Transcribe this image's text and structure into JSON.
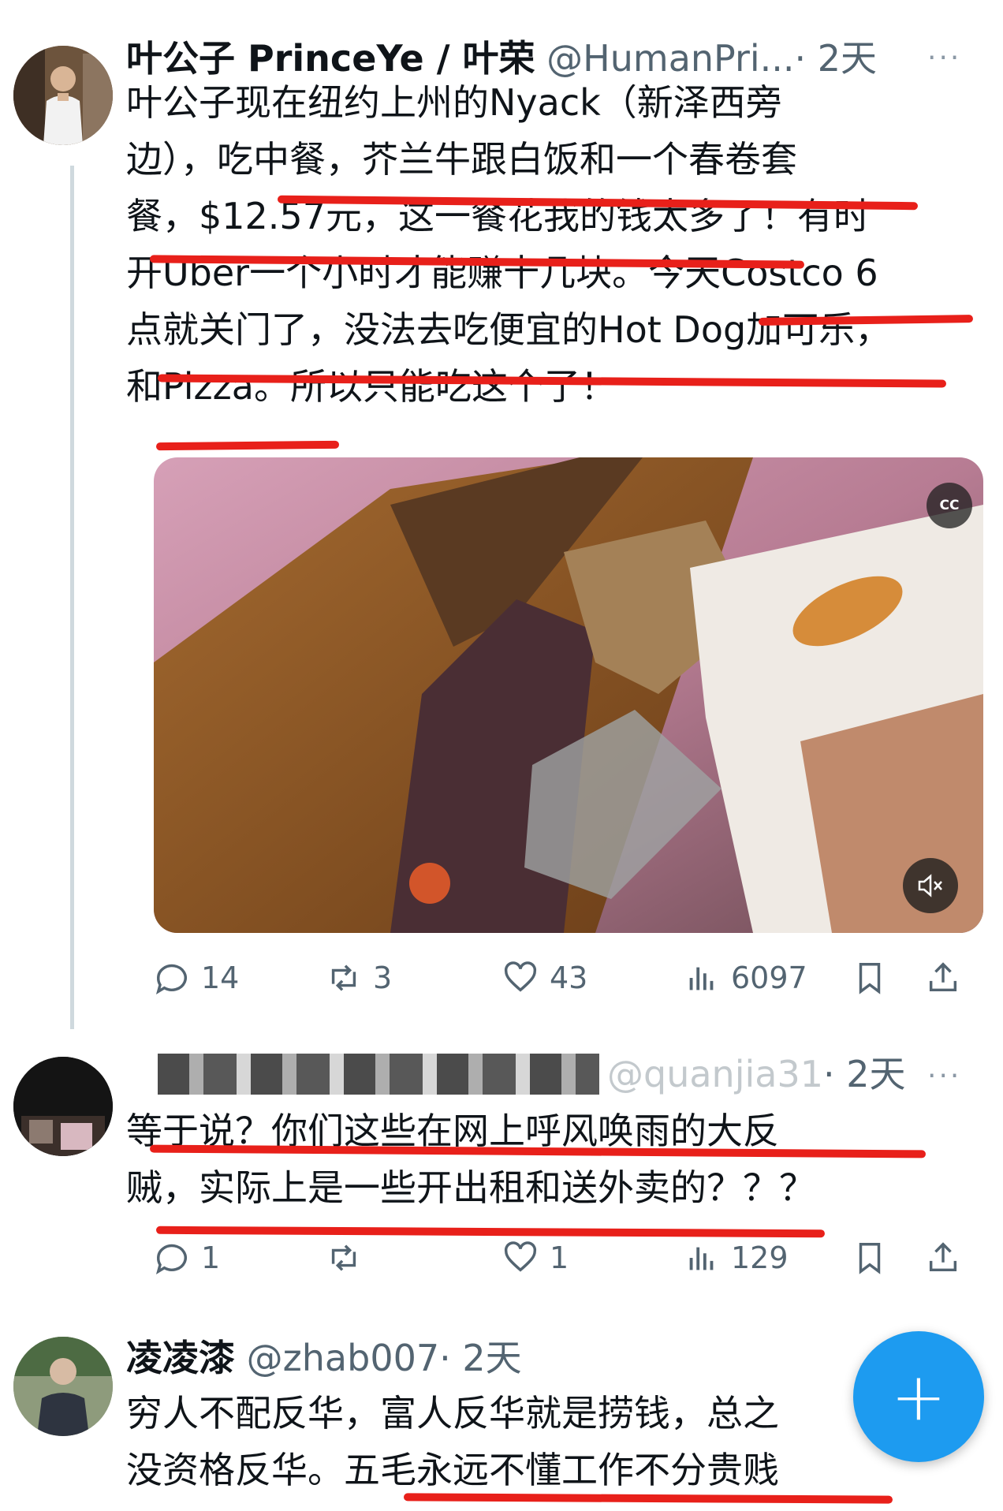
{
  "tweet1": {
    "name": "叶公子 PrinceYe / 叶荣",
    "handle": "@HumanPri...",
    "time": "· 2天",
    "lines": [
      "叶公子现在纽约上州的Nyack（新泽西旁",
      "边），吃中餐，芥兰牛跟白饭和一个春卷套",
      "餐，$12.57元，这一餐花我的钱太多了！有时",
      "开Uber一个小时才能赚十几块。今天Costco 6",
      "点就关门了，没法去吃便宜的Hot Dog加可乐，",
      "和Pizza。所以只能吃这个了！"
    ],
    "media": {
      "cc_label": "CC"
    },
    "actions": {
      "replies": "14",
      "retweets": "3",
      "likes": "43",
      "views": "6097"
    }
  },
  "tweet2": {
    "name": "",
    "handle": "@quanjia31",
    "time": "· 2天",
    "lines": [
      "等于说？你们这些在网上呼风唤雨的大反",
      "贼，实际上是一些开出租和送外卖的？？？"
    ],
    "actions": {
      "replies": "1",
      "retweets": "",
      "likes": "1",
      "views": "129"
    }
  },
  "tweet3": {
    "name": "凌凌漆",
    "handle": "@zhab007",
    "time": "· 2天",
    "lines": [
      "穷人不配反华，富人反华就是捞钱，总之",
      "没资格反华。五毛永远不懂工作不分贵贱"
    ]
  },
  "fab_label": "+",
  "more_label": "···",
  "colors": {
    "accent": "#1d9bf0",
    "underline": "#e8201a",
    "secondary_text": "#536471"
  }
}
